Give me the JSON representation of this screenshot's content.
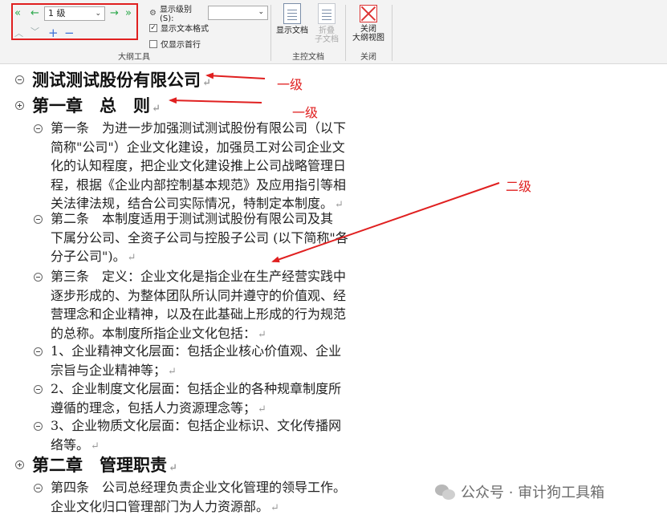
{
  "ribbon": {
    "outline_tools": {
      "label": "大纲工具",
      "level_value": "1 级",
      "show_level_label": "显示级别(S):",
      "show_level_value": "",
      "show_format_label": "显示文本格式",
      "show_format_checked": true,
      "first_line_label": "仅显示首行",
      "first_line_checked": false
    },
    "master_doc": {
      "label": "主控文档",
      "show_doc_label": "显示文档",
      "collapse_sub_label_1": "折叠",
      "collapse_sub_label_2": "子文档"
    },
    "close_group": {
      "label": "关闭",
      "close_label_1": "关闭",
      "close_label_2": "大纲视图"
    }
  },
  "document": {
    "title": "测试测试股份有限公司",
    "chapter1": "第一章　总　则",
    "paragraphs": [
      {
        "lines": [
          "第一条　为进一步加强测试测试股份有限公司（以下",
          "简称\"公司\"）企业文化建设，加强员工对公司企业文",
          "化的认知程度，把企业文化建设推上公司战略管理日",
          "程，根据《企业内部控制基本规范》及应用指引等相",
          "关法律法规，结合公司实际情况，特制定本制度。"
        ]
      },
      {
        "lines": [
          "第二条　本制度适用于测试测试股份有限公司及其",
          "下属分公司、全资子公司与控股子公司 (以下简称\"各",
          "分子公司\")。"
        ]
      },
      {
        "lines": [
          "第三条　定义：企业文化是指企业在生产经营实践中",
          "逐步形成的、为整体团队所认同并遵守的价值观、经",
          "营理念和企业精神，以及在此基础上形成的行为规范",
          "的总称。本制度所指企业文化包括："
        ]
      },
      {
        "lines": [
          "1、企业精神文化层面：包括企业核心价值观、企业",
          "宗旨与企业精神等；"
        ]
      },
      {
        "lines": [
          "2、企业制度文化层面：包括企业的各种规章制度所",
          "遵循的理念，包括人力资源理念等；"
        ]
      },
      {
        "lines": [
          "3、企业物质文化层面：包括企业标识、文化传播网",
          "络等。"
        ]
      }
    ],
    "chapter2": "第二章　管理职责",
    "paragraph4": {
      "lines": [
        "第四条　公司总经理负责企业文化管理的领导工作。",
        "企业文化归口管理部门为人力资源部。"
      ]
    },
    "para_mark": "↵"
  },
  "annotations": {
    "level1_a": "一级",
    "level1_b": "一级",
    "level2": "二级"
  },
  "watermark": {
    "text": "公众号 · 审计狗工具箱"
  },
  "colors": {
    "annotation_red": "#e02020",
    "promote_green": "#2aa84a",
    "plus_minus_blue": "#3a6fd8"
  }
}
